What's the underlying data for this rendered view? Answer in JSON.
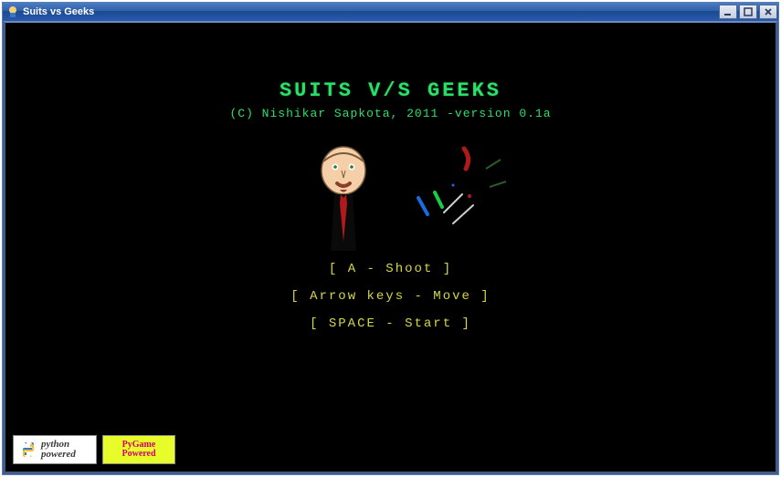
{
  "window": {
    "title": "Suits vs Geeks"
  },
  "game": {
    "title": "SUITS V/S GEEKS",
    "subtitle": "(C) Nishikar Sapkota, 2011 -version 0.1a",
    "instructions": [
      "[ A - Shoot ]",
      "[ Arrow keys - Move ]",
      "[ SPACE - Start ]"
    ]
  },
  "badges": {
    "python": "python powered",
    "pygame": "PyGame Powered"
  },
  "colors": {
    "title_green": "#2be06a",
    "instruction_yellow": "#d6d648",
    "tie_red": "#b01a1a"
  }
}
